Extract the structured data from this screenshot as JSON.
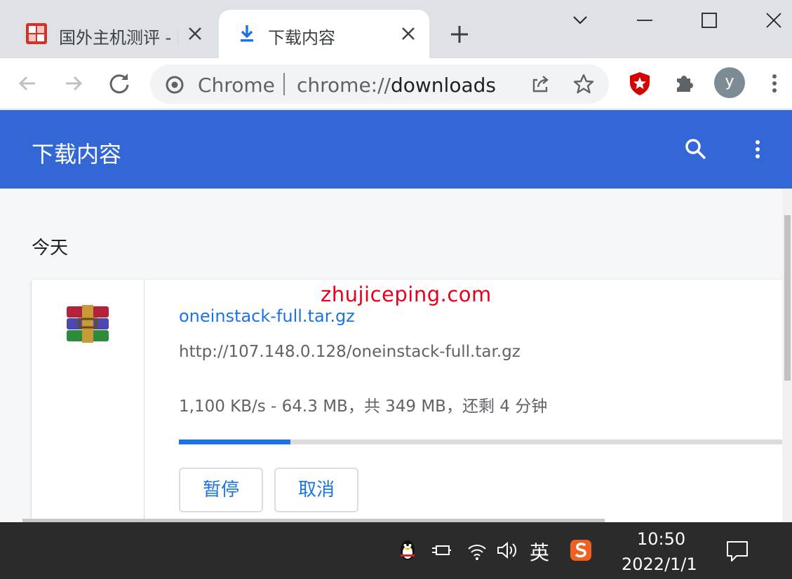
{
  "tabs": [
    {
      "title": "国外主机测评 - 国",
      "active": false
    },
    {
      "title": "下载内容",
      "active": true
    }
  ],
  "omnibox": {
    "scheme_label": "Chrome",
    "url_prefix": "chrome://",
    "url_host": "downloads"
  },
  "profile": {
    "initial": "y"
  },
  "downloads_page": {
    "title": "下载内容",
    "section_date": "今天",
    "watermark": "zhujiceping.com",
    "item": {
      "file_name": "oneinstack-full.tar.gz",
      "url": "http://107.148.0.128/oneinstack-full.tar.gz",
      "status": "1,100 KB/s - 64.3 MB，共 349 MB，还剩 4 分钟",
      "progress_fraction": 0.184,
      "pause_label": "暂停",
      "cancel_label": "取消"
    }
  },
  "taskbar": {
    "ime": "英",
    "time": "10:50",
    "date": "2022/1/1"
  },
  "colors": {
    "header_blue": "#3367d6",
    "link_blue": "#1a73e8",
    "watermark_red": "#e8001c",
    "taskbar": "#2b2b2b"
  },
  "icons": [
    "favicon-site-icon",
    "download-icon",
    "close-icon",
    "plus-icon",
    "chevron-down-icon",
    "minimize-icon",
    "maximize-icon",
    "back-arrow-icon",
    "forward-arrow-icon",
    "reload-icon",
    "chrome-logo-icon",
    "share-icon",
    "star-icon",
    "shield-extension-icon",
    "puzzle-icon",
    "kebab-menu-icon",
    "search-icon",
    "archive-file-icon",
    "qq-penguin-icon",
    "power-plug-icon",
    "wifi-icon",
    "volume-icon",
    "sogou-ime-icon",
    "notification-icon"
  ]
}
